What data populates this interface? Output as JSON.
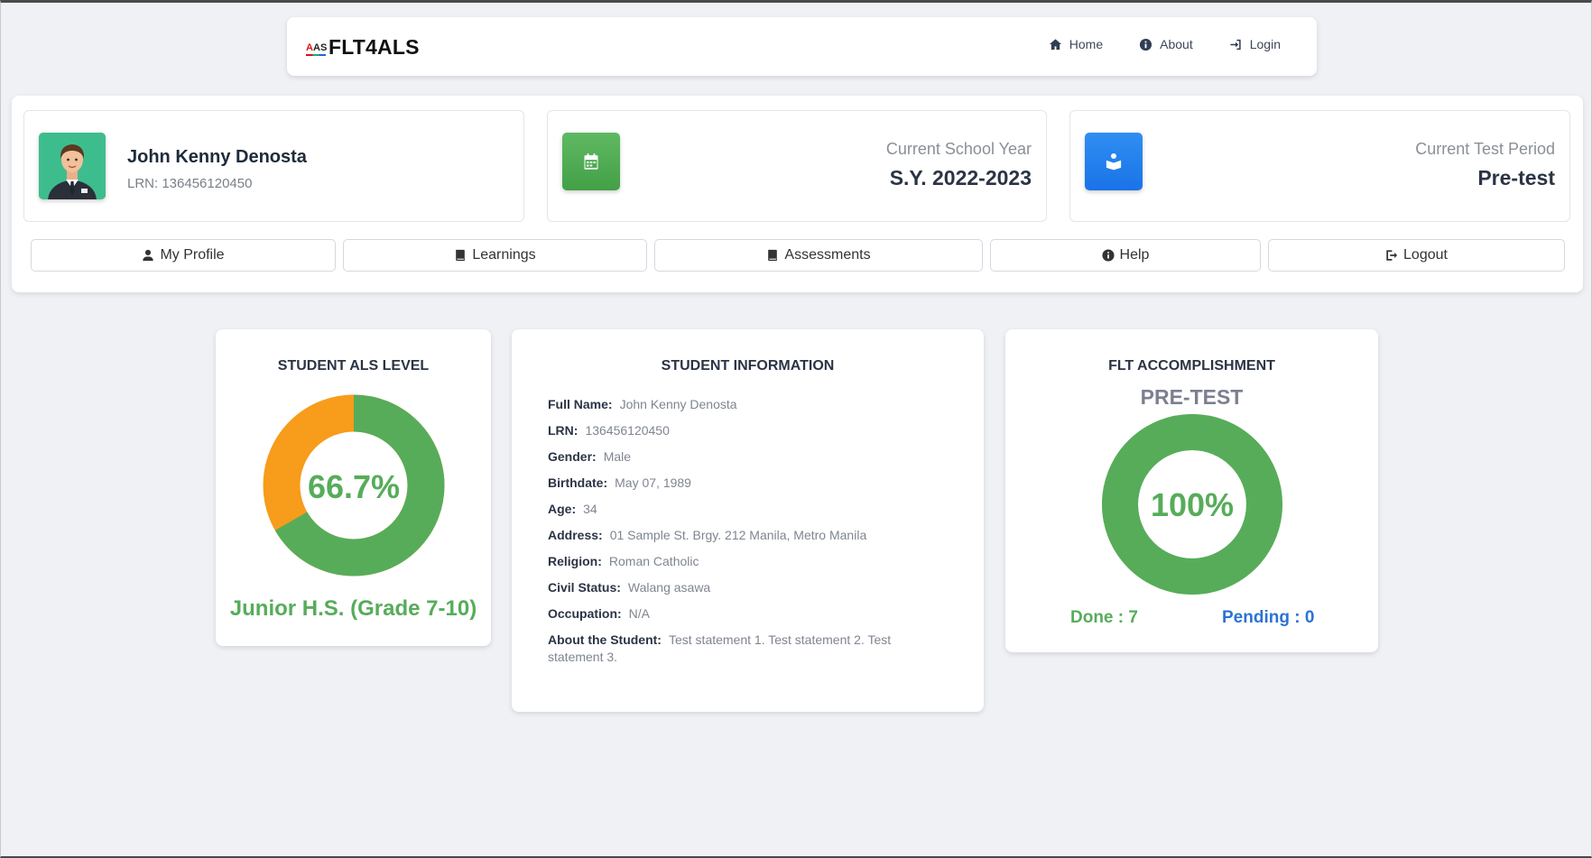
{
  "navbar": {
    "brand": "FLT4ALS",
    "logo_text": "AS",
    "links": [
      {
        "label": "Home",
        "icon": "home-icon"
      },
      {
        "label": "About",
        "icon": "info-icon"
      },
      {
        "label": "Login",
        "icon": "login-icon"
      }
    ]
  },
  "profile": {
    "name": "John Kenny Denosta",
    "lrn": "LRN: 136456120450"
  },
  "school_year": {
    "label": "Current School Year",
    "value": "S.Y. 2022-2023",
    "icon": "calendar-icon"
  },
  "test_period": {
    "label": "Current Test Period",
    "value": "Pre-test",
    "icon": "book-reader-icon"
  },
  "menu": {
    "profile": "My Profile",
    "learnings": "Learnings",
    "assessments": "Assessments",
    "help": "Help",
    "logout": "Logout"
  },
  "level_card": {
    "title": "STUDENT ALS LEVEL",
    "percent_label": "66.7%",
    "percent": 66.7,
    "caption": "Junior H.S. (Grade 7-10)",
    "colors": {
      "done": "#57ac5a",
      "remaining": "#f79c1b"
    }
  },
  "info_card": {
    "title": "STUDENT INFORMATION",
    "rows": [
      {
        "k": "Full Name:",
        "v": "John Kenny Denosta"
      },
      {
        "k": "LRN:",
        "v": "136456120450"
      },
      {
        "k": "Gender:",
        "v": "Male"
      },
      {
        "k": "Birthdate:",
        "v": "May 07, 1989"
      },
      {
        "k": "Age:",
        "v": "34"
      },
      {
        "k": "Address:",
        "v": "01 Sample St. Brgy. 212 Manila, Metro Manila"
      },
      {
        "k": "Religion:",
        "v": "Roman Catholic"
      },
      {
        "k": "Civil Status:",
        "v": "Walang asawa"
      },
      {
        "k": "Occupation:",
        "v": "N/A"
      },
      {
        "k": "About the Student:",
        "v": "Test statement 1. Test statement 2. Test statement 3."
      }
    ]
  },
  "flt_card": {
    "title": "FLT ACCOMPLISHMENT",
    "subtitle": "PRE-TEST",
    "percent_label": "100%",
    "percent": 100,
    "done": "Done : 7",
    "pending": "Pending : 0",
    "colors": {
      "done": "#57ac5a",
      "pending": "#2c73d2"
    }
  }
}
